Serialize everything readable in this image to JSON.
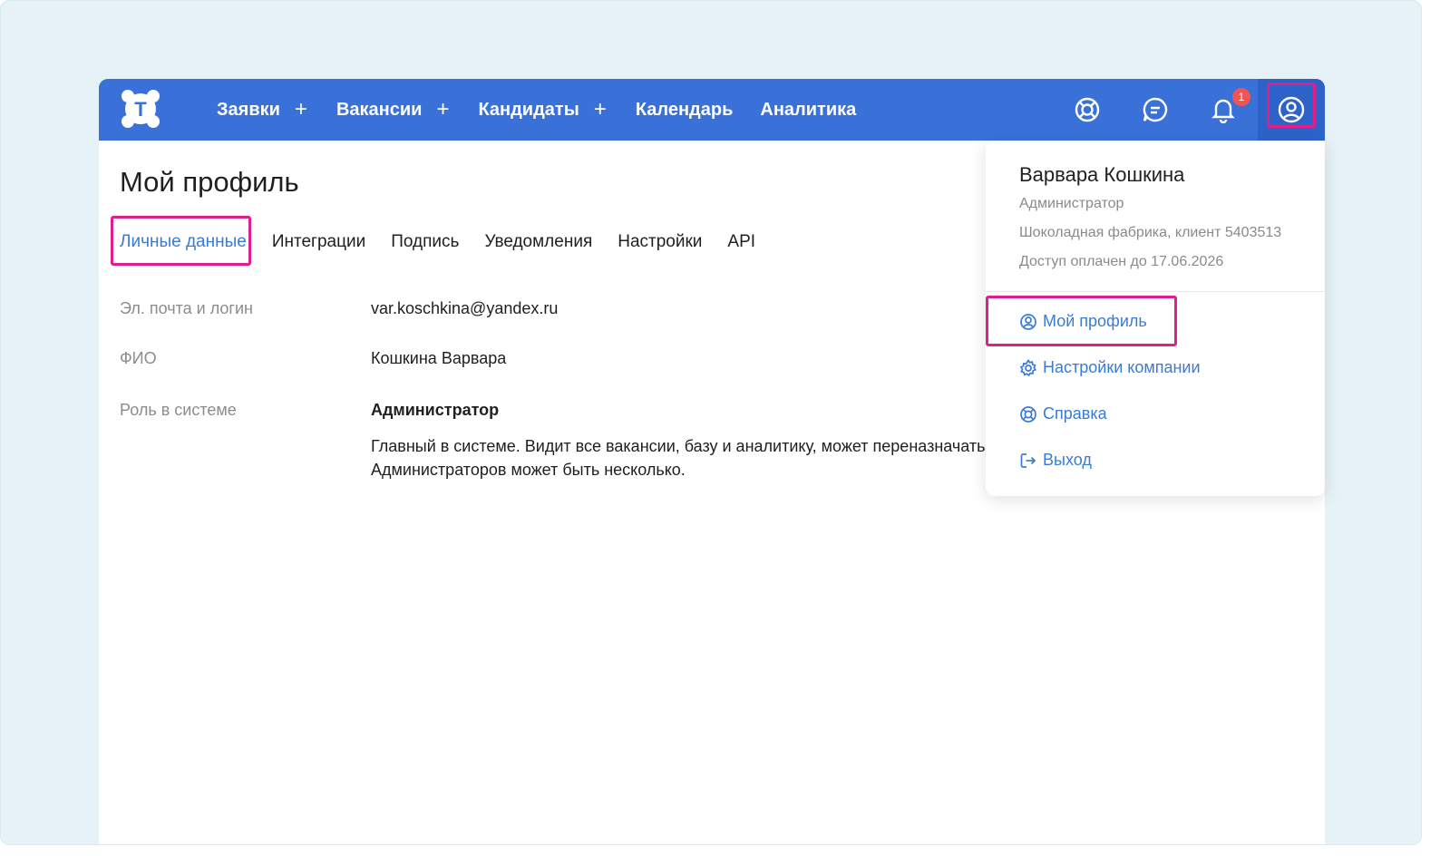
{
  "topbar": {
    "logo_letter": "T",
    "nav": [
      {
        "label": "Заявки",
        "has_add": true
      },
      {
        "label": "Вакансии",
        "has_add": true
      },
      {
        "label": "Кандидаты",
        "has_add": true
      },
      {
        "label": "Календарь",
        "has_add": false
      },
      {
        "label": "Аналитика",
        "has_add": false
      }
    ],
    "add_glyph": "+",
    "icons": [
      "help-icon",
      "chat-icon",
      "bell-icon",
      "user-icon"
    ],
    "notification_count": "1",
    "colors": {
      "bar": "#3a71d8",
      "badge": "#f25454",
      "highlight": "#e0208a"
    }
  },
  "page": {
    "title": "Мой профиль",
    "tabs": [
      "Личные данные",
      "Интеграции",
      "Подпись",
      "Уведомления",
      "Настройки",
      "API"
    ],
    "active_tab": "Личные данные",
    "fields": {
      "email_label": "Эл. почта и логин",
      "email_value": "var.koschkina@yandex.ru",
      "name_label": "ФИО",
      "name_value": "Кошкина Варвара",
      "role_label": "Роль в системе",
      "role_value": "Администратор",
      "role_desc_line1": "Главный в системе. Видит все вакансии, базу и аналитику, может переназначать р",
      "role_desc_line2": "Администраторов может быть несколько."
    }
  },
  "dropdown": {
    "user_name": "Варвара Кошкина",
    "role": "Администратор",
    "company": "Шоколадная фабрика, клиент 5403513",
    "access": "Доступ оплачен до 17.06.2026",
    "items": [
      {
        "label": "Мой профиль",
        "icon": "user-circle-icon"
      },
      {
        "label": "Настройки компании",
        "icon": "gear-icon"
      },
      {
        "label": "Справка",
        "icon": "lifebuoy-icon"
      },
      {
        "label": "Выход",
        "icon": "logout-icon"
      }
    ]
  }
}
